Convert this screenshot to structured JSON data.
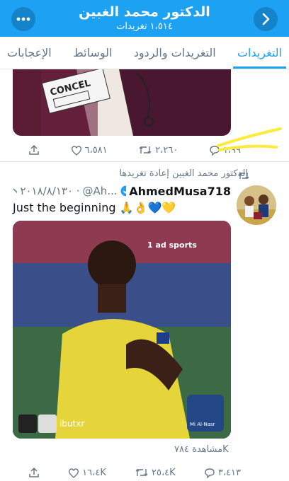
{
  "header": {
    "title": "الدكتور محمد الغبين",
    "subtitle": "١،٥١٤ تغريدات",
    "more_icon": "more-dots-icon",
    "back_icon": "chevron-right-icon",
    "color": "#1da1f2"
  },
  "tabs": [
    {
      "label": "التغريدات",
      "active": true
    },
    {
      "label": "التغريدات والردود",
      "active": false
    },
    {
      "label": "الوسائط",
      "active": false
    },
    {
      "label": "الإعجابات",
      "active": false
    }
  ],
  "tweet1": {
    "image_text": "CONCEL",
    "replies": "١،٩٩",
    "retweets": "٢،٢٦٠",
    "likes": "٦،٥٨١"
  },
  "tweet2": {
    "retweeted_by": "الدكتور محمد الغبين إعادة تغريدها",
    "name": "AhmedMusa718",
    "verified": true,
    "handle": "@Ah...",
    "date": "٢٠١٨/٨/١٣٠ ·",
    "text": "Just the beginning 🙏👌💙💛",
    "video_logo": "1 ad sports",
    "video_watermark": "ibutxr",
    "video_brand": "Mi Al-Nasr",
    "views": "مشاهدة ٧٨٤K",
    "replies": "٣،٤١٣",
    "retweets": "٢٥،٤K",
    "likes": "١٦،٤K"
  }
}
